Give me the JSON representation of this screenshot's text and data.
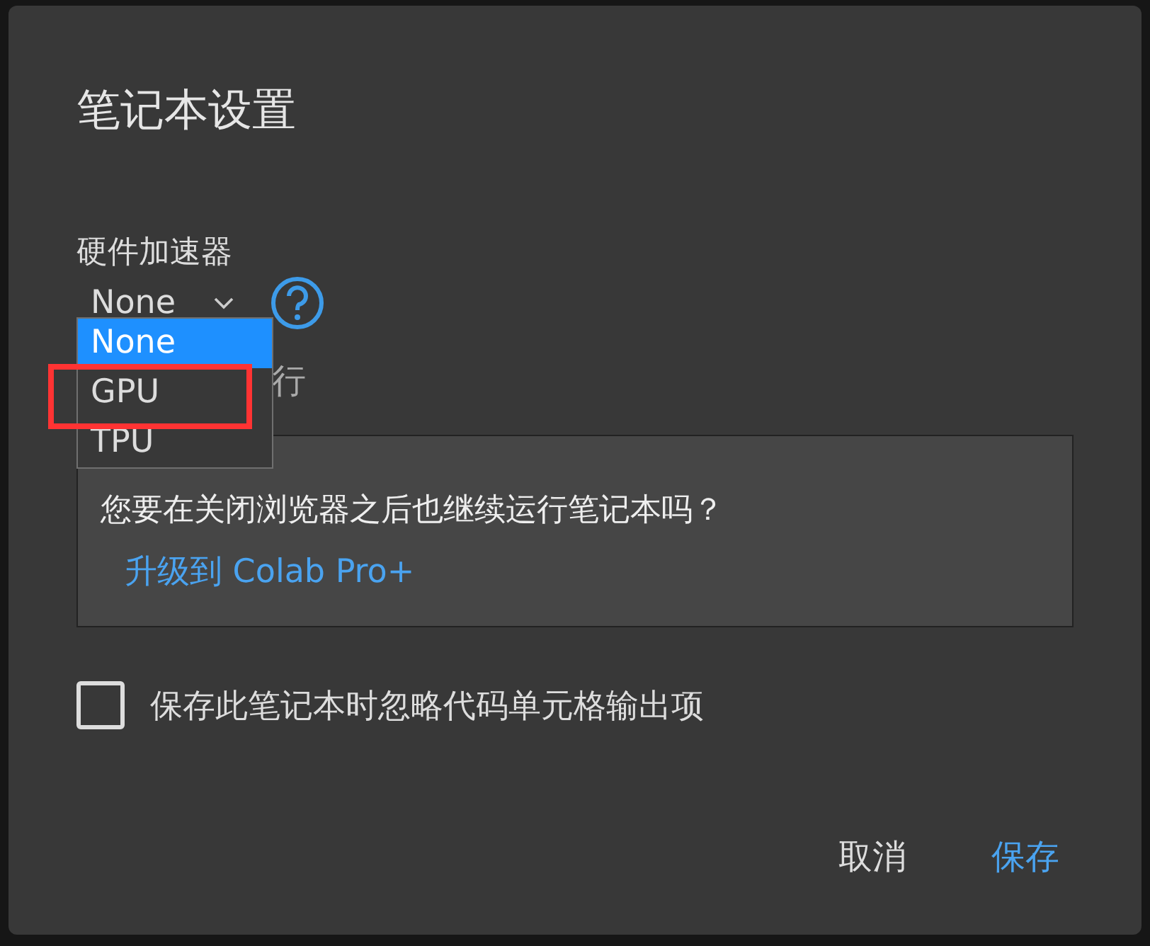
{
  "dialog": {
    "title": "笔记本设置",
    "accelerator": {
      "label": "硬件加速器",
      "value": "None",
      "options": [
        {
          "label": "None",
          "selected": true,
          "highlighted": false
        },
        {
          "label": "GPU",
          "selected": false,
          "highlighted": true
        },
        {
          "label": "TPU",
          "selected": false,
          "highlighted": false
        }
      ]
    },
    "covered_label": "行",
    "upsell": {
      "question": "您要在关闭浏览器之后也继续运行笔记本吗？",
      "link": "升级到 Colab Pro+"
    },
    "omit_output": {
      "label": "保存此笔记本时忽略代码单元格输出项",
      "checked": false
    },
    "buttons": [
      {
        "label": "取消",
        "kind": "cancel"
      },
      {
        "label": "保存",
        "kind": "primary"
      }
    ]
  }
}
